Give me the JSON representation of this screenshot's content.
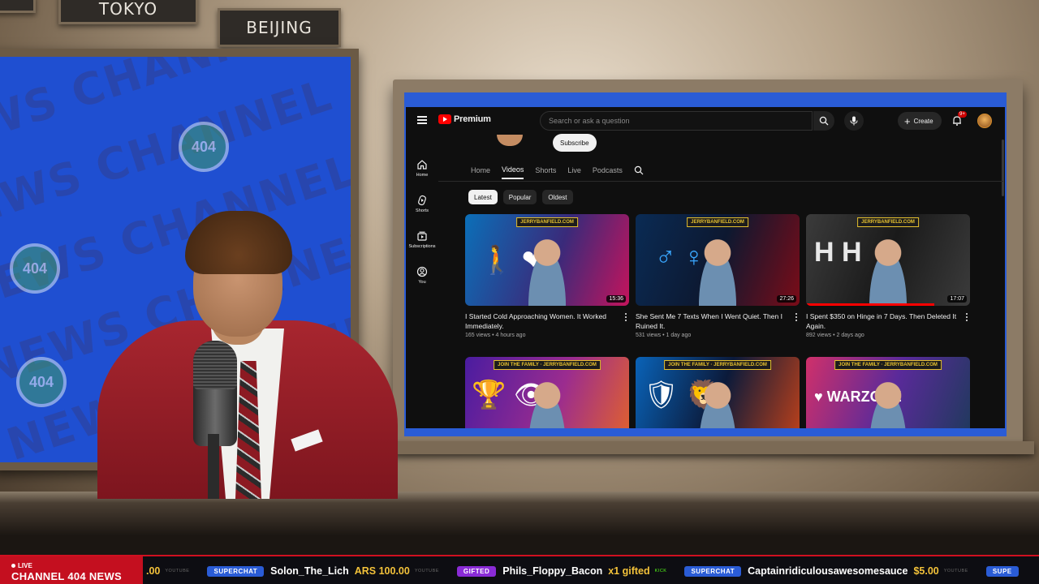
{
  "studio": {
    "city_signs": [
      "",
      "TOKYO",
      "BEIJING"
    ],
    "wall_text": "NEWS CHANNEL",
    "wall_logo_text": "404"
  },
  "youtube": {
    "logo_text": "Premium",
    "search": {
      "placeholder": "Search or ask a question"
    },
    "create_label": "Create",
    "notifications_badge": "9+",
    "sidebar": [
      {
        "label": "Home",
        "icon": "home-icon"
      },
      {
        "label": "Shorts",
        "icon": "shorts-icon"
      },
      {
        "label": "Subscriptions",
        "icon": "subscriptions-icon"
      },
      {
        "label": "You",
        "icon": "you-icon"
      }
    ],
    "subscribe_label": "Subscribe",
    "tabs": [
      {
        "label": "Home",
        "active": false
      },
      {
        "label": "Videos",
        "active": true
      },
      {
        "label": "Shorts",
        "active": false
      },
      {
        "label": "Live",
        "active": false
      },
      {
        "label": "Podcasts",
        "active": false
      }
    ],
    "chips": [
      {
        "label": "Latest",
        "active": true
      },
      {
        "label": "Popular",
        "active": false
      },
      {
        "label": "Oldest",
        "active": false
      }
    ],
    "videos": [
      {
        "title": "I Started Cold Approaching Women. It Worked Immediately.",
        "views": "165 views",
        "age": "4 hours ago",
        "duration": "15:36",
        "brand": "JERRYBANFIELD.COM",
        "art": "🚶 ❤",
        "progress": 0
      },
      {
        "title": "She Sent Me 7 Texts When I Went Quiet. Then I Ruined It.",
        "views": "531 views",
        "age": "1 day ago",
        "duration": "27:26",
        "brand": "JERRYBANFIELD.COM",
        "art": "♂ ♀",
        "progress": 0
      },
      {
        "title": "I Spent $350 on Hinge in 7 Days. Then Deleted It Again.",
        "views": "892 views",
        "age": "2 days ago",
        "duration": "17:07",
        "brand": "JERRYBANFIELD.COM",
        "art": "H H",
        "progress": 0.78
      },
      {
        "title": "",
        "views": "",
        "age": "",
        "duration": "",
        "brand": "JOIN THE FAMILY · JERRYBANFIELD.COM",
        "art": "🏆 👁",
        "progress": 0
      },
      {
        "title": "",
        "views": "",
        "age": "",
        "duration": "",
        "brand": "JOIN THE FAMILY · JERRYBANFIELD.COM",
        "art": "🛡 🦁",
        "progress": 0
      },
      {
        "title": "",
        "views": "",
        "age": "",
        "duration": "",
        "brand": "JOIN THE FAMILY · JERRYBANFIELD.COM",
        "art": "♥ WARZONE",
        "progress": 0
      }
    ]
  },
  "ticker": {
    "live_label": "LIVE",
    "brand": "CHANNEL 404 NEWS",
    "items": [
      {
        "type": "",
        "type_color": "",
        "user": "",
        "amount": ".00",
        "source": "YOUTUBE"
      },
      {
        "type": "SUPERCHAT",
        "type_color": "#2a5cd6",
        "user": "Solon_The_Lich",
        "amount": "ARS 100.00",
        "source": "YOUTUBE"
      },
      {
        "type": "GIFTED",
        "type_color": "#8a2bd6",
        "user": "Phils_Floppy_Bacon",
        "amount": "x1 gifted",
        "source": "KICK"
      },
      {
        "type": "SUPERCHAT",
        "type_color": "#2a5cd6",
        "user": "Captainridiculousawesomesauce",
        "amount": "$5.00",
        "source": "YOUTUBE"
      },
      {
        "type": "SUPE",
        "type_color": "#2a5cd6",
        "user": "",
        "amount": "",
        "source": ""
      }
    ]
  }
}
